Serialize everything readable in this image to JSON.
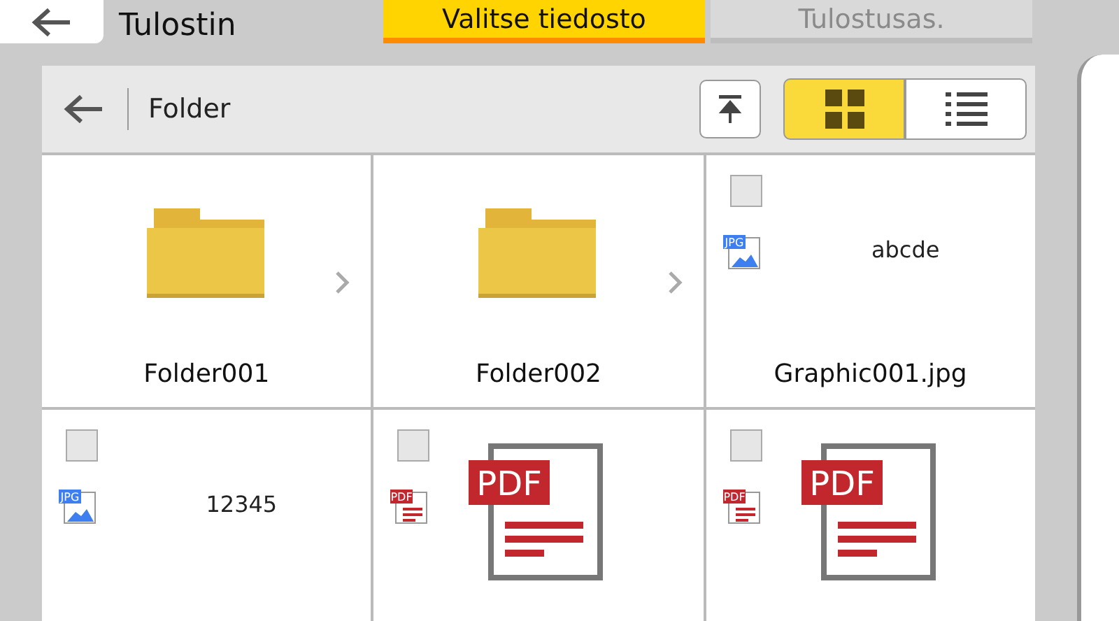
{
  "header": {
    "title": "Tulostin"
  },
  "tabs": [
    {
      "label": "Valitse tiedosto",
      "selected": true,
      "disabled": false
    },
    {
      "label": "Tulostusas.",
      "selected": false,
      "disabled": true
    }
  ],
  "browser": {
    "path": "Folder",
    "views": [
      {
        "kind": "grid",
        "selected": true
      },
      {
        "kind": "list",
        "selected": false
      }
    ]
  },
  "items": [
    {
      "kind": "folder",
      "name": "Folder001"
    },
    {
      "kind": "folder",
      "name": "Folder002"
    },
    {
      "kind": "image",
      "checked": false,
      "badge": "JPG",
      "preview": "abcde",
      "name": "Graphic001.jpg"
    },
    {
      "kind": "image",
      "checked": false,
      "badge": "JPG",
      "preview": "12345"
    },
    {
      "kind": "pdf",
      "checked": false,
      "badge": "PDF",
      "preview": "PDF"
    },
    {
      "kind": "pdf",
      "checked": false,
      "badge": "PDF",
      "preview": "PDF"
    }
  ]
}
